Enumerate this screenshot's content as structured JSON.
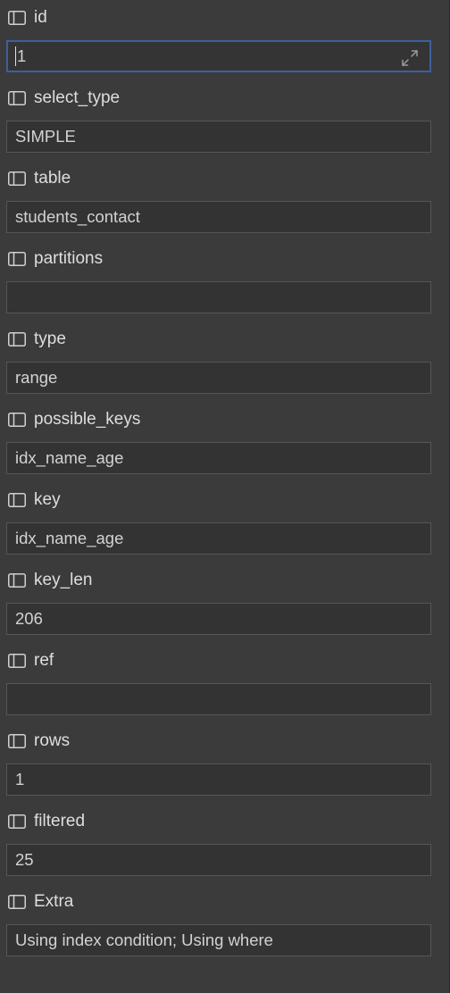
{
  "fields": [
    {
      "label": "id",
      "value": "1"
    },
    {
      "label": "select_type",
      "value": "SIMPLE"
    },
    {
      "label": "table",
      "value": "students_contact"
    },
    {
      "label": "partitions",
      "value": ""
    },
    {
      "label": "type",
      "value": "range"
    },
    {
      "label": "possible_keys",
      "value": "idx_name_age"
    },
    {
      "label": "key",
      "value": "idx_name_age"
    },
    {
      "label": "key_len",
      "value": "206"
    },
    {
      "label": "ref",
      "value": ""
    },
    {
      "label": "rows",
      "value": "1"
    },
    {
      "label": "filtered",
      "value": "25"
    },
    {
      "label": "Extra",
      "value": "Using index condition; Using where"
    }
  ],
  "icons": {
    "column": "column-icon",
    "expand": "expand-icon"
  },
  "colors": {
    "background": "#3b3b3b",
    "field_background": "#333333",
    "field_border": "#565656",
    "focus_border": "#3d5f9e",
    "text": "#d4d4d4"
  }
}
